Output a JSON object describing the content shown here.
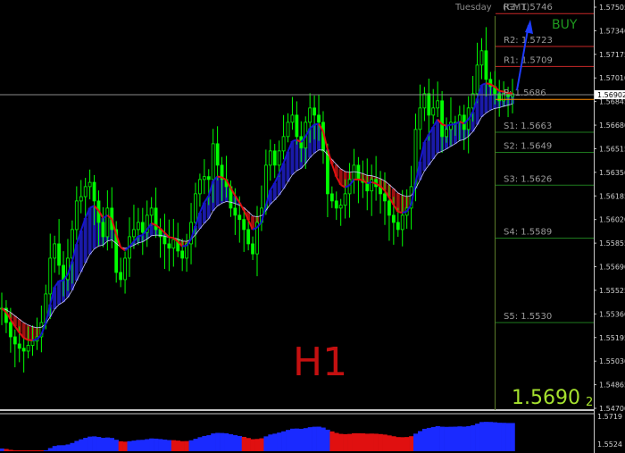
{
  "header": {
    "day_label": "Tuesday",
    "gmt_label": "(GMT)"
  },
  "timeframe_label": "H1",
  "signal_label": "BUY",
  "current_price": {
    "main": "1.5690",
    "sub": "2",
    "axis_label": "1.56902"
  },
  "pivot_levels": [
    {
      "name": "R3",
      "label": "R3: 1.5746",
      "value": 1.5746,
      "color": "#c82828"
    },
    {
      "name": "R2",
      "label": "R2: 1.5723",
      "value": 1.5723,
      "color": "#c82828"
    },
    {
      "name": "R1",
      "label": "R1: 1.5709",
      "value": 1.5709,
      "color": "#c82828"
    },
    {
      "name": "P",
      "label": "P: 1.5686",
      "value": 1.5686,
      "color": "#ff8c00"
    },
    {
      "name": "S1",
      "label": "S1: 1.5663",
      "value": 1.5663,
      "color": "#1e7a1e"
    },
    {
      "name": "S2",
      "label": "S2: 1.5649",
      "value": 1.5649,
      "color": "#1e7a1e"
    },
    {
      "name": "S3",
      "label": "S3: 1.5626",
      "value": 1.5626,
      "color": "#1e7a1e"
    },
    {
      "name": "S4",
      "label": "S4: 1.5589",
      "value": 1.5589,
      "color": "#1e7a1e"
    },
    {
      "name": "S5",
      "label": "S5: 1.5530",
      "value": 1.553,
      "color": "#1e7a1e"
    }
  ],
  "price_axis": {
    "ticks": [
      "1.57505",
      "1.57340",
      "1.57175",
      "1.57010",
      "1.56845",
      "1.56680",
      "1.56515",
      "1.56350",
      "1.56185",
      "1.56020",
      "1.55855",
      "1.55690",
      "1.55525",
      "1.55360",
      "1.55195",
      "1.55030",
      "1.54865",
      "1.54700"
    ]
  },
  "sub_axis": {
    "top_label": "1.5719",
    "bottom_label": "1.5524"
  },
  "colors": {
    "background": "#000000",
    "candle": "#00ff00",
    "ma_fast": "#1515d0",
    "ma_bear": "#e01010",
    "ma_slow": "#c8c8ff",
    "fill_bull": "#1a1aa8",
    "fill_bear": "#a01010",
    "sub_bull": "#1a2aff",
    "sub_bear": "#e01010",
    "arrow": "#1e3cff"
  },
  "chart_data": {
    "type": "line",
    "title": "",
    "ylim": [
      1.547,
      1.5755
    ],
    "close": [
      1.554,
      1.553,
      1.552,
      1.5515,
      1.5512,
      1.551,
      1.5514,
      1.5517,
      1.552,
      1.553,
      1.555,
      1.5575,
      1.5585,
      1.557,
      1.556,
      1.5575,
      1.5595,
      1.5615,
      1.5618,
      1.5625,
      1.5628,
      1.5615,
      1.56,
      1.559,
      1.561,
      1.5595,
      1.5565,
      1.556,
      1.5575,
      1.559,
      1.5595,
      1.56,
      1.5593,
      1.5605,
      1.561,
      1.5595,
      1.559,
      1.5585,
      1.5582,
      1.5588,
      1.558,
      1.5575,
      1.5585,
      1.56,
      1.562,
      1.563,
      1.5632,
      1.563,
      1.5655,
      1.564,
      1.563,
      1.5625,
      1.561,
      1.5605,
      1.5602,
      1.5595,
      1.5585,
      1.5578,
      1.56,
      1.561,
      1.564,
      1.565,
      1.564,
      1.565,
      1.566,
      1.567,
      1.5675,
      1.566,
      1.5652,
      1.567,
      1.568,
      1.5675,
      1.567,
      1.565,
      1.562,
      1.5615,
      1.561,
      1.5612,
      1.562,
      1.563,
      1.564,
      1.563,
      1.5628,
      1.5622,
      1.563,
      1.5625,
      1.562,
      1.5615,
      1.5605,
      1.56,
      1.5595,
      1.5605,
      1.561,
      1.5625,
      1.5665,
      1.568,
      1.569,
      1.5675,
      1.568,
      1.5685,
      1.566,
      1.5665,
      1.567,
      1.567,
      1.5675,
      1.5665,
      1.568,
      1.569,
      1.571,
      1.572,
      1.57,
      1.5695,
      1.569,
      1.5685,
      1.569,
      1.5688,
      1.569
    ]
  }
}
